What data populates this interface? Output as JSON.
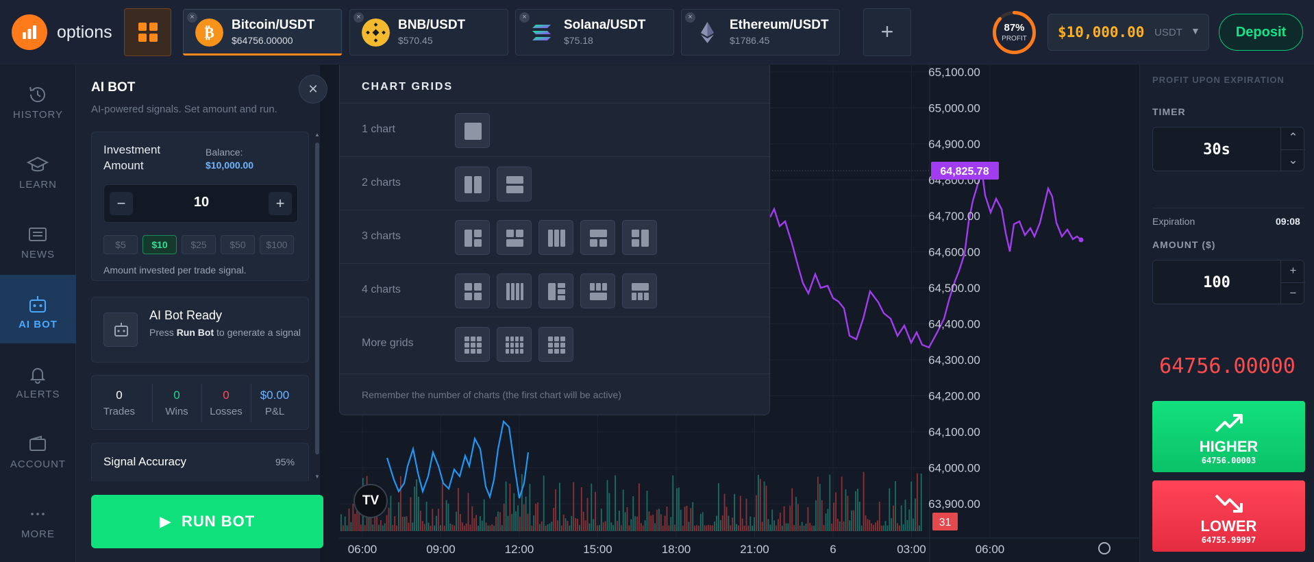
{
  "brand": {
    "name": "options"
  },
  "tabs": [
    {
      "name": "Bitcoin/USDT",
      "price": "$64756.00000",
      "coin": "bitcoin-icon",
      "color": "#f7931a",
      "active": true
    },
    {
      "name": "BNB/USDT",
      "price": "$570.45",
      "coin": "bnb-icon",
      "color": "#f3ba2f"
    },
    {
      "name": "Solana/USDT",
      "price": "$75.18",
      "coin": "solana-icon",
      "color": "#9945ff"
    },
    {
      "name": "Ethereum/USDT",
      "price": "$1786.45",
      "coin": "ethereum-icon",
      "color": "#627eea"
    }
  ],
  "profit": {
    "percent": "87%",
    "label": "PROFIT",
    "fraction": 0.87
  },
  "balance": {
    "amount": "$10,000.00",
    "currency": "USDT"
  },
  "deposit_label": "Deposit",
  "nav": [
    {
      "label": "HISTORY",
      "icon": "history-icon"
    },
    {
      "label": "LEARN",
      "icon": "graduation-cap-icon"
    },
    {
      "label": "NEWS",
      "icon": "newspaper-icon"
    },
    {
      "label": "AI BOT",
      "icon": "robot-icon",
      "active": true
    },
    {
      "label": "ALERTS",
      "icon": "bell-icon"
    },
    {
      "label": "ACCOUNT",
      "icon": "wallet-icon"
    },
    {
      "label": "MORE",
      "icon": "more-dots-icon"
    }
  ],
  "bot": {
    "title": "AI BOT",
    "subtitle": "AI-powered signals. Set amount and run.",
    "investment_title": "Investment Amount",
    "balance_label": "Balance:",
    "balance_value": "$10,000.00",
    "amount": "10",
    "presets": [
      "$5",
      "$10",
      "$25",
      "$50",
      "$100"
    ],
    "selected_preset": "$10",
    "note": "Amount invested per trade signal.",
    "ready_title": "AI Bot Ready",
    "ready_desc_pre": "Press ",
    "ready_desc_bold": "Run Bot",
    "ready_desc_post": " to generate a signal",
    "stats": [
      {
        "value": "0",
        "label": "Trades",
        "color": "#ffffff"
      },
      {
        "value": "0",
        "label": "Wins",
        "color": "#1fd98a"
      },
      {
        "value": "0",
        "label": "Losses",
        "color": "#ff4b5c"
      },
      {
        "value": "$0.00",
        "label": "P&L",
        "color": "#6fb4ff"
      }
    ],
    "accuracy_label": "Signal Accuracy",
    "accuracy_value": "95%",
    "run_label": "RUN BOT"
  },
  "grid_popup": {
    "title": "CHART GRIDS",
    "rows": [
      {
        "label": "1 chart",
        "count": 1
      },
      {
        "label": "2 charts",
        "count": 2
      },
      {
        "label": "3 charts",
        "count": 5
      },
      {
        "label": "4 charts",
        "count": 5
      },
      {
        "label": "More grids",
        "count": 3
      }
    ],
    "footer": "Remember the number of charts (the first chart will be active)"
  },
  "chart_data": {
    "type": "line",
    "y_ticks": [
      "65,100.00",
      "65,000.00",
      "64,900.00",
      "64,800.00",
      "64,700.00",
      "64,600.00",
      "64,500.00",
      "64,400.00",
      "64,300.00",
      "64,200.00",
      "64,100.00",
      "64,000.00",
      "63,900.00"
    ],
    "x_ticks": [
      "06:00",
      "09:00",
      "12:00",
      "15:00",
      "18:00",
      "21:00",
      "6",
      "03:00",
      "06:00"
    ],
    "current_price_label": "64,825.78",
    "current_price": 64825.78,
    "ylim": [
      63850,
      65120
    ],
    "line_color": "#a23cf0",
    "down_color": "#2196f3",
    "timeframe_badge": "31",
    "watermark": "TV"
  },
  "right_panel": {
    "header": "PROFIT UPON EXPIRATION",
    "timer_label": "TIMER",
    "timer_value": "30s",
    "expiration_label": "Expiration",
    "expiration_value": "09:08",
    "amount_label": "AMOUNT ($)",
    "amount_value": "100",
    "price": "64756.00000",
    "higher_label": "HIGHER",
    "higher_value": "64756.00003",
    "lower_label": "LOWER",
    "lower_value": "64755.99997"
  }
}
